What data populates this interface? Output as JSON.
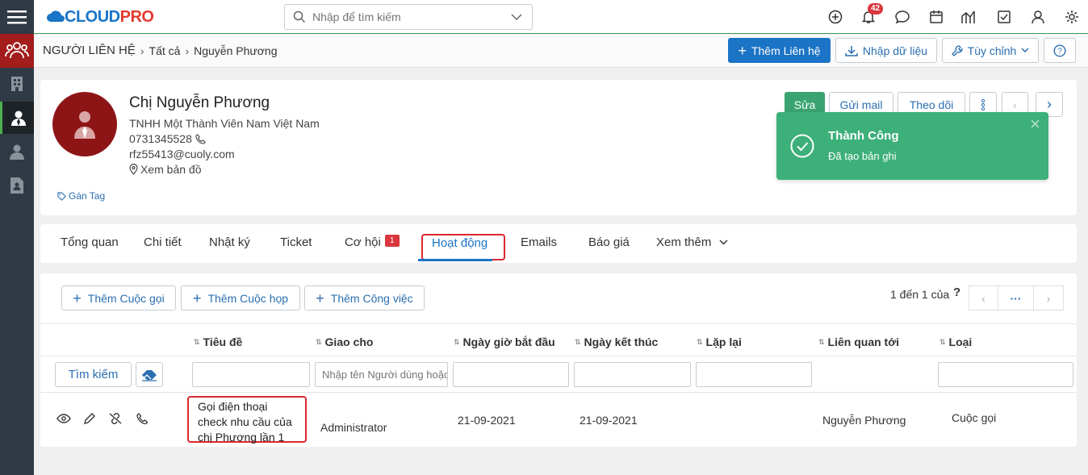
{
  "app": {
    "logo": "CLOUDPRO",
    "logo_main": "CLOUD",
    "logo_accent": "PRO"
  },
  "search": {
    "placeholder": "Nhập để tìm kiếm"
  },
  "notifications": {
    "count": "42"
  },
  "breadcrumb": {
    "module": "NGƯỜI LIÊN HỆ",
    "all": "Tất cả",
    "current": "Nguyễn Phương"
  },
  "toolbar": {
    "add_contact": "Thêm Liên hệ",
    "import": "Nhập dữ liệu",
    "customize": "Tùy chỉnh"
  },
  "profile": {
    "name": "Chị Nguyễn Phương",
    "company": "TNHH Một Thành Viên Nam Việt Nam",
    "phone": "0731345528",
    "email": "rfz55413@cuoly.com",
    "map": "Xem bản đồ",
    "tag": "Gán Tag",
    "edit": "Sửa",
    "send_mail": "Gửi mail",
    "follow": "Theo dõi"
  },
  "toast": {
    "title": "Thành Công",
    "message": "Đã tạo bản ghi"
  },
  "tabs": [
    {
      "label": "Tổng quan"
    },
    {
      "label": "Chi tiết"
    },
    {
      "label": "Nhật ký"
    },
    {
      "label": "Ticket"
    },
    {
      "label": "Cơ hội",
      "badge": "1"
    },
    {
      "label": "Hoạt động"
    },
    {
      "label": "Emails"
    },
    {
      "label": "Báo giá"
    },
    {
      "label": "Xem thêm"
    }
  ],
  "activity": {
    "add_call": "Thêm Cuộc gọi",
    "add_meeting": "Thêm Cuộc họp",
    "add_task": "Thêm Công việc",
    "pager": "1 đến 1 của",
    "pager_help": "?",
    "pager_more": "···",
    "search_button": "Tìm kiếm",
    "columns": [
      "Tiêu đề",
      "Giao cho",
      "Ngày giờ bắt đầu",
      "Ngày kết thúc",
      "Lặp lại",
      "Liên quan tới",
      "Loại"
    ],
    "assignee_placeholder": "Nhập tên Người dùng hoặc",
    "rows": [
      {
        "title": "Gọi điện thoại check nhu cầu của chị Phương lần 1",
        "assignee": "Administrator",
        "start": "21-09-2021",
        "end": "21-09-2021",
        "repeat": "",
        "related": "Nguyễn Phương",
        "type": "Cuộc gọi"
      }
    ]
  }
}
